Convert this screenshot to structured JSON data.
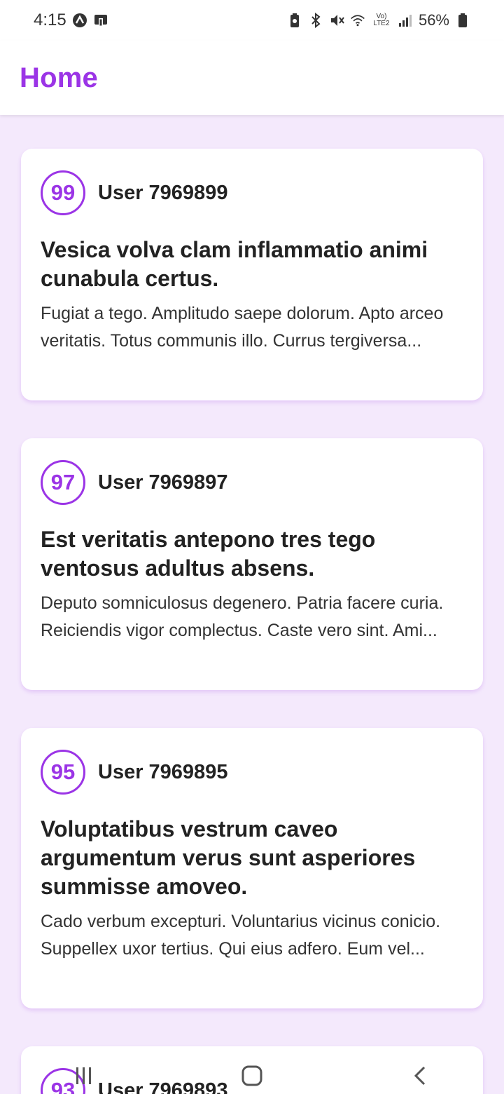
{
  "status_bar": {
    "time": "4:15",
    "battery": "56%",
    "network": "Vo) LTE2"
  },
  "app_bar": {
    "title": "Home"
  },
  "posts": [
    {
      "score": "99",
      "user": "User 7969899",
      "title": "Vesica volva clam inflammatio animi cunabula certus.",
      "body": "Fugiat a tego. Amplitudo saepe dolorum. Apto arceo veritatis. Totus communis illo. Currus tergiversa..."
    },
    {
      "score": "97",
      "user": "User 7969897",
      "title": "Est veritatis antepono tres tego ventosus adultus absens.",
      "body": "Deputo somniculosus degenero. Patria facere curia. Reiciendis vigor complectus. Caste vero sint. Ami..."
    },
    {
      "score": "95",
      "user": "User 7969895",
      "title": "Voluptatibus vestrum caveo argumentum verus sunt asperiores summisse amoveo.",
      "body": "Cado verbum excepturi. Voluntarius vicinus conicio. Suppellex uxor tertius. Qui eius adfero. Eum vel..."
    },
    {
      "score": "93",
      "user": "User 7969893",
      "title": "",
      "body": ""
    }
  ],
  "colors": {
    "accent": "#9b34e6",
    "background": "#f4e9fc",
    "card": "#ffffff"
  },
  "nav": {
    "icons": [
      "recents-icon",
      "home-icon",
      "back-icon"
    ]
  }
}
